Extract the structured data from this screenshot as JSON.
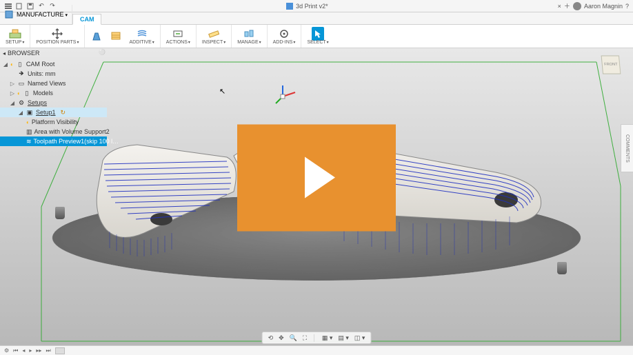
{
  "titlebar": {
    "doc_title": "3d Print v2*",
    "user_name": "Aaron Magnin"
  },
  "workspace": {
    "label": "MANUFACTURE"
  },
  "tabs": {
    "active": "CAM"
  },
  "ribbon": {
    "setup": "SETUP",
    "position_parts": "POSITION PARTS",
    "additive": "ADDITIVE",
    "actions": "ACTIONS",
    "inspect": "INSPECT",
    "manage": "MANAGE",
    "add_ins": "ADD-INS",
    "select": "SELECT"
  },
  "browser": {
    "header": "BROWSER",
    "items": {
      "root": "CAM Root",
      "units": "Units: mm",
      "named_views": "Named Views",
      "models": "Models",
      "setups": "Setups",
      "setup1": "Setup1",
      "platform": "Platform Visibility",
      "area_support": "Area with Volume Support2",
      "toolpath": "Toolpath Preview1(skip 100 l…"
    }
  },
  "viewcube": {
    "face": "FRONT"
  },
  "comments_rail": "COMMENTS"
}
